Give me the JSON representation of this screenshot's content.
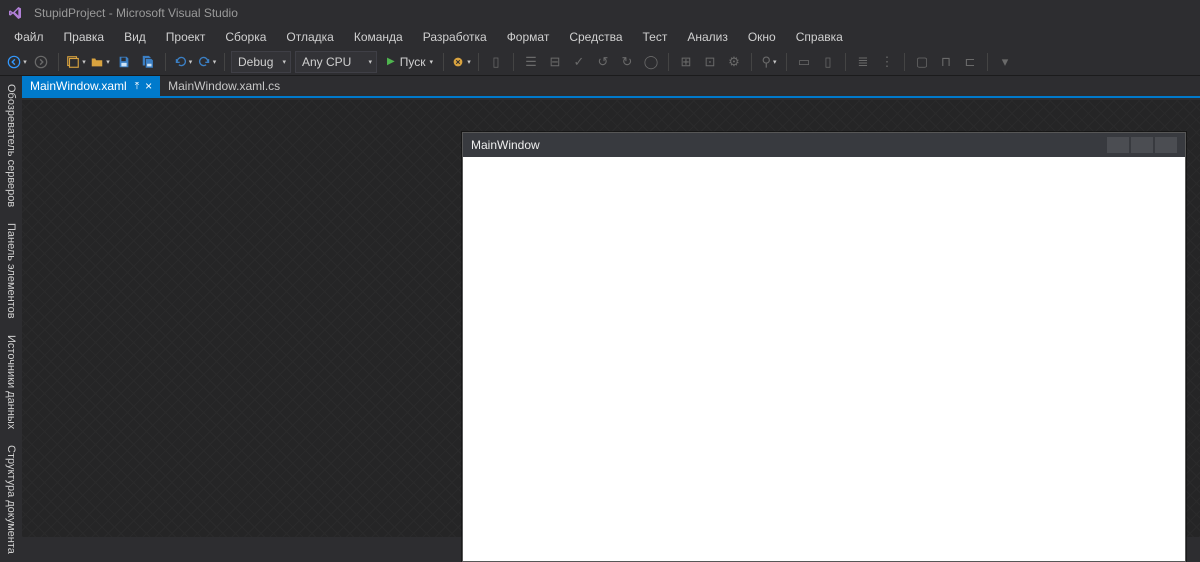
{
  "title": "StupidProject - Microsoft Visual Studio",
  "menu": [
    "Файл",
    "Правка",
    "Вид",
    "Проект",
    "Сборка",
    "Отладка",
    "Команда",
    "Разработка",
    "Формат",
    "Средства",
    "Тест",
    "Анализ",
    "Окно",
    "Справка"
  ],
  "toolbar": {
    "config": "Debug",
    "platform": "Any CPU",
    "start": "Пуск"
  },
  "tabs": [
    {
      "label": "MainWindow.xaml",
      "active": true,
      "pinned": true
    },
    {
      "label": "MainWindow.xaml.cs",
      "active": false,
      "pinned": false
    }
  ],
  "side_tabs": [
    "Обозреватель серверов",
    "Панель элементов",
    "Источники данных",
    "Структура документа"
  ],
  "designer": {
    "window_title": "MainWindow"
  }
}
